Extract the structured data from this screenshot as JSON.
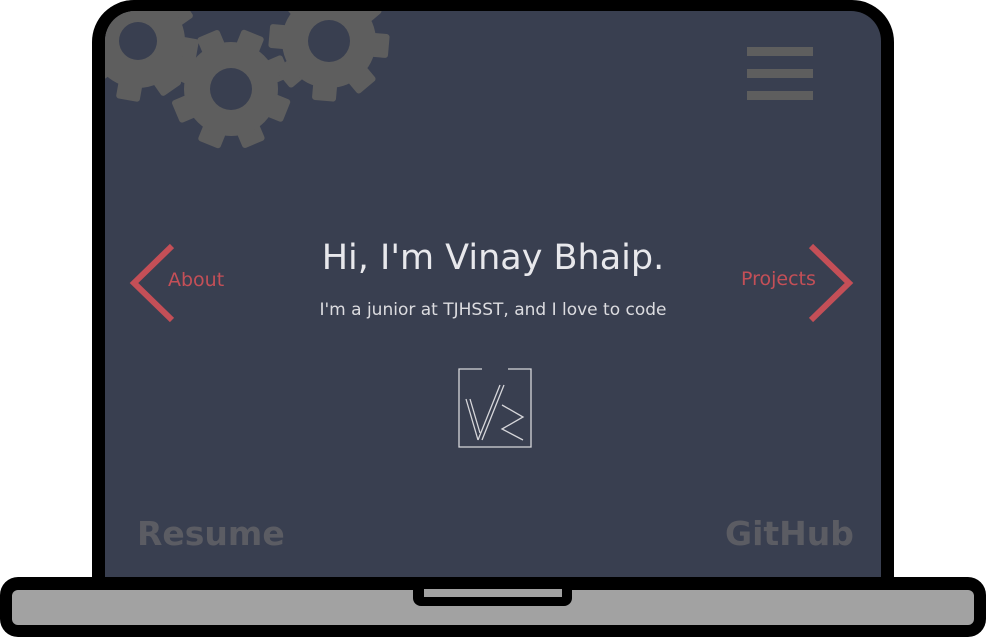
{
  "hero": {
    "title": "Hi, I'm Vinay Bhaip.",
    "subtitle": "I'm a junior at TJHSST, and I love to code"
  },
  "nav": {
    "left_label": "About",
    "right_label": "Projects"
  },
  "footer": {
    "resume_label": "Resume",
    "github_label": "GitHub"
  },
  "icons": {
    "menu": "hamburger-menu-icon",
    "left_arrow": "chevron-left-icon",
    "right_arrow": "chevron-right-icon",
    "gears": "gears-icon",
    "logo": "vb-logo"
  },
  "colors": {
    "screen_background": "#393f50",
    "accent_red": "#c44f57",
    "gear_gray": "#5e5e5e",
    "footer_link_gray": "#5b5c63",
    "frame": "#000000",
    "laptop_base": "#a2a2a2"
  }
}
